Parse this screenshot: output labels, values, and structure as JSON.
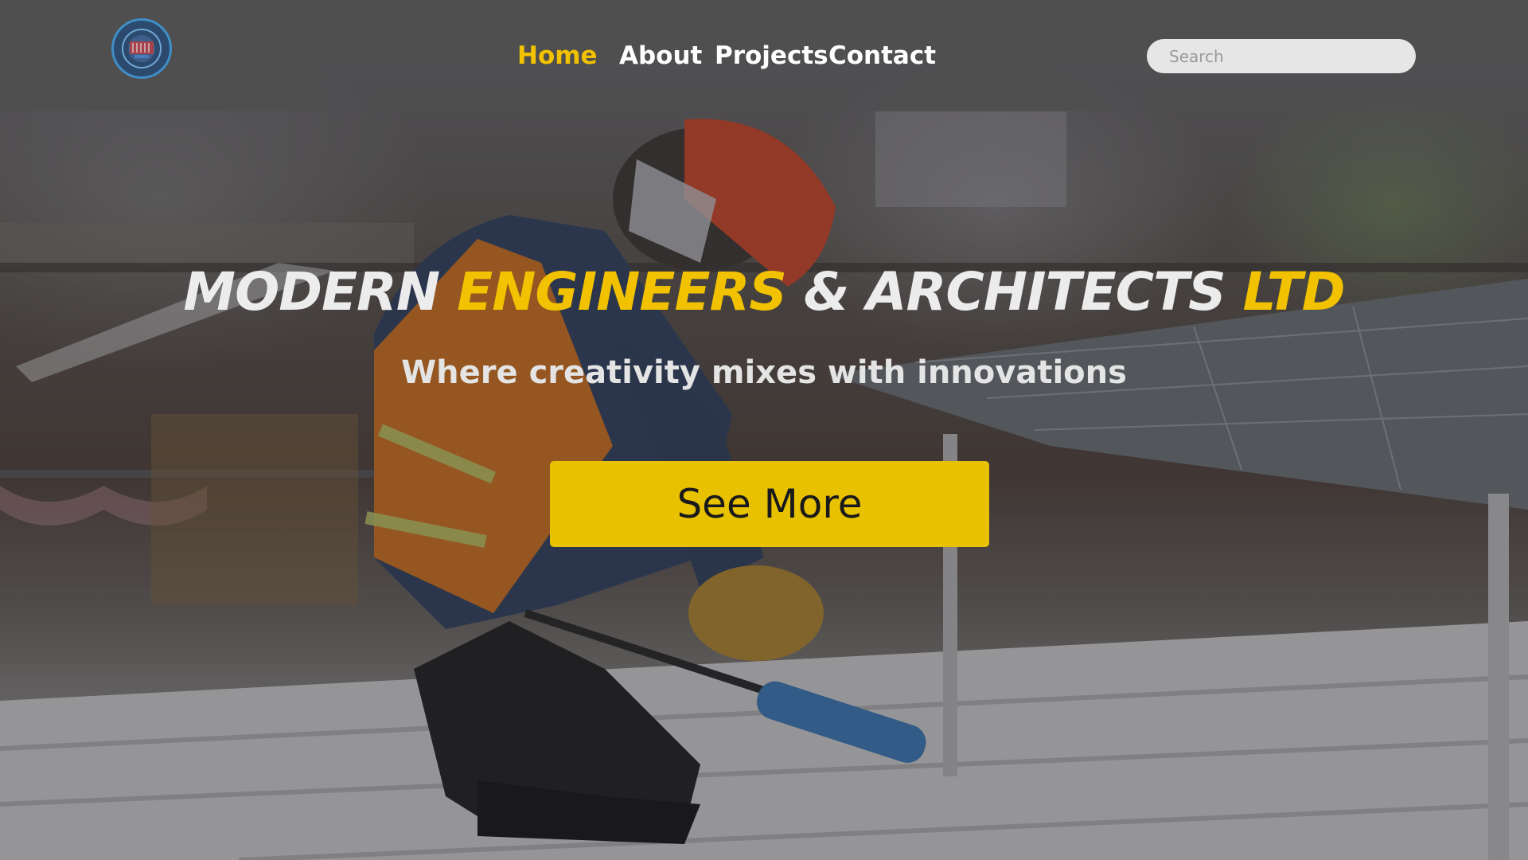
{
  "header": {
    "logo_icon": "company-seal-logo",
    "nav": [
      {
        "label": "Home",
        "active": true
      },
      {
        "label": "About",
        "active": false
      },
      {
        "label": "Projects",
        "active": false
      },
      {
        "label": "Contact",
        "active": false
      }
    ],
    "search": {
      "placeholder": "Search",
      "value": ""
    }
  },
  "hero": {
    "title_parts": [
      {
        "text": "MODERN ",
        "color": "#ececec"
      },
      {
        "text": "ENGINEERS",
        "color": "#f2c200"
      },
      {
        "text": " & ARCHITECTS ",
        "color": "#ececec"
      },
      {
        "text": "LTD",
        "color": "#f2c200"
      }
    ],
    "subtitle": "Where creativity mixes with innovations",
    "cta_label": "See More"
  },
  "colors": {
    "accent": "#f2c200",
    "button": "#e8c200",
    "header_bg": "#4e4e50",
    "nav_text": "#ffffff"
  }
}
